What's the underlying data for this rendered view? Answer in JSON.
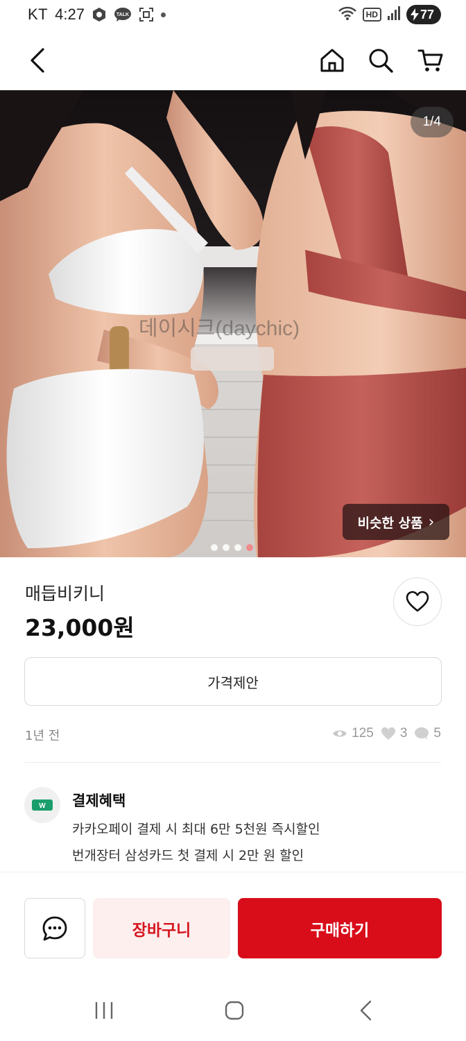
{
  "status_bar": {
    "carrier": "KT",
    "time": "4:27",
    "talk_badge": "TALK",
    "hd_label": "HD",
    "battery": "77",
    "icons": [
      "gallery-icon",
      "talk-icon",
      "screenshot-icon",
      "notification-dot-icon",
      "wifi-icon",
      "signal-icon",
      "battery-icon"
    ]
  },
  "top_nav": {
    "icons": [
      "back-icon",
      "home-icon",
      "search-icon",
      "cart-icon"
    ]
  },
  "hero": {
    "counter": "1/4",
    "watermark": "데이시크(daychic)",
    "similar_button": "비슷한 상품",
    "similar_chevron": "›",
    "dot_count": 4,
    "active_dot": 4
  },
  "product": {
    "name": "매듭비키니",
    "price": "23,000원"
  },
  "offer_button": "가격제안",
  "meta": {
    "posted": "1년 전",
    "views": "125",
    "likes": "3",
    "chats": "5"
  },
  "benefit": {
    "title": "결제혜택",
    "badge": "W",
    "line1": "카카오페이 결제 시 최대 6만 5천원 즉시할인",
    "line2": "번개장터 삼성카드 첫 결제 시 2만 원  할인"
  },
  "actions": {
    "cart_label": "장바구니",
    "buy_label": "구매하기"
  },
  "colors": {
    "accent_red": "#d90c1a",
    "cart_bg": "#fcefee",
    "badge_green": "#1a9e6b"
  }
}
